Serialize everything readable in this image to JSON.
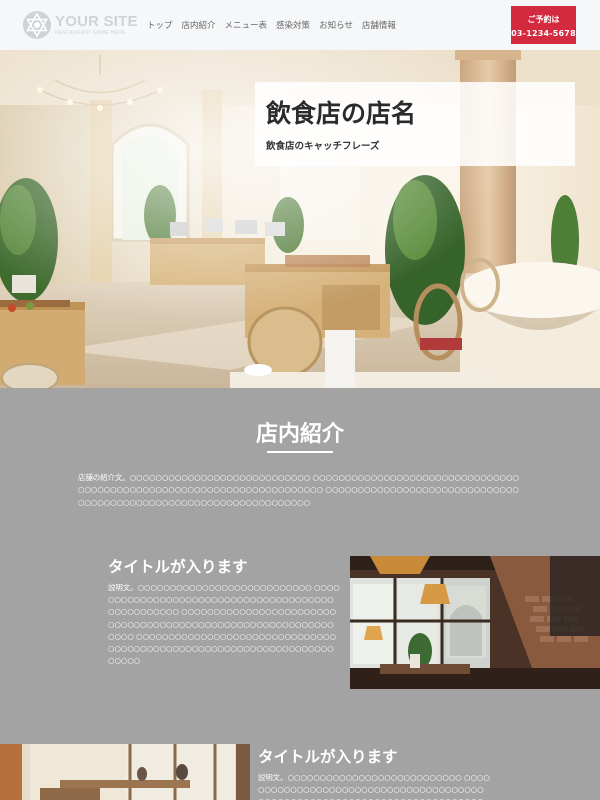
{
  "header": {
    "logo_main": "YOUR SITE",
    "logo_sub": "RESTAURANT NAME HERE",
    "nav": [
      "トップ",
      "店内紹介",
      "メニュー表",
      "感染対策",
      "お知らせ",
      "店舗情報"
    ],
    "reserve_label": "ご予約は",
    "reserve_tel": "03-1234-5678"
  },
  "hero": {
    "title": "飲食店の店名",
    "catch": "飲食店のキャッチフレーズ"
  },
  "intro_section": {
    "title": "店内紹介",
    "text": "店舗の紹介文。○○○○○○○○○○○○○○○○○○○○○○○○○○○○ ○○○○○○○○○○○○○○○○○○○○○○○○○○○○○○○○○○○○○○○○○○○○○○○○○○○○○○○○○○○○○○○○○○○○○○ ○○○○○○○○○○○○○○○○○○○○○○○○○○○○○○○○○○○○○○○○○○○○○○○○○○○○○○○○○○○○○○○○○○"
  },
  "features": [
    {
      "title": "タイトルが入ります",
      "text": "説明文。○○○○○○○○○○○○○○○○○○○○○○○○○○○ ○○○○○○○○○○○○○○○○○○○○○○○○○○○○○○○○○○○○○○○○○○○○○○○○○○ ○○○○○○○○○○○○○○○○○○○○○○○○○○○○○○○○○○○○○○○○○○○○○○○○○○○○○○○○○○○○○○○ ○○○○○○○○○○○○○○○○○○○○○○○○○○○○○○○○○○○○○○○○○○○○○○○○○○○○○○○○○○○○○○○○○○○○○○○"
    },
    {
      "title": "タイトルが入ります",
      "text": "説明文。○○○○○○○○○○○○○○○○○○○○○○○○○○○ ○○○○○○○○○○○○○○○○○○○○○○○○○○○○○○○○○○○○○○○○○○○○○○○○○○○○○○○○○○○○○○○○○○○○○○○○○○○○○○○○○○○○○○○○○○○○○○○○○○○○○○"
    }
  ]
}
